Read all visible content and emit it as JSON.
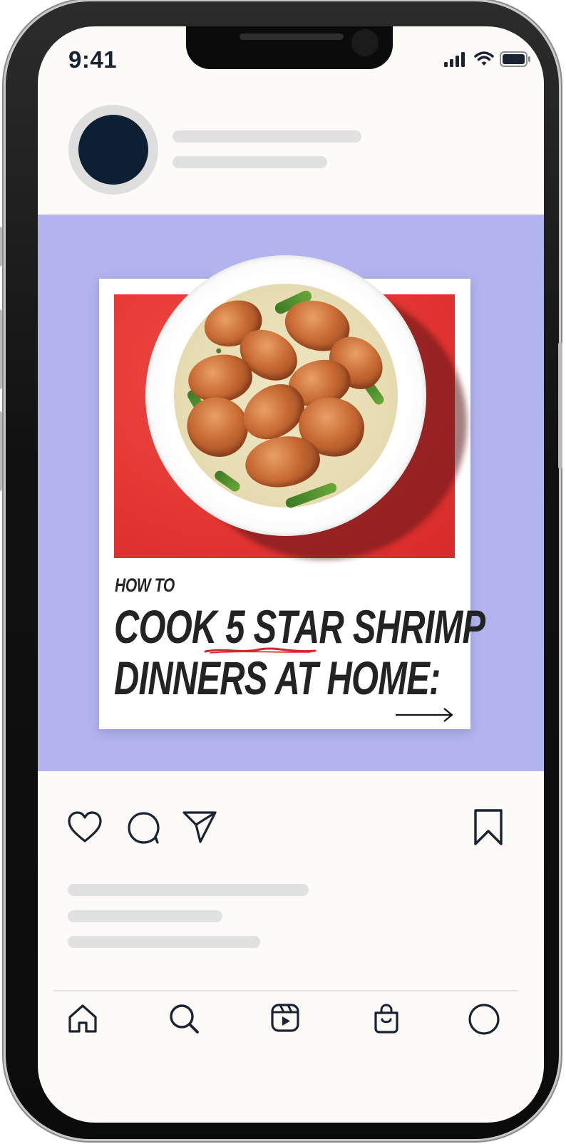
{
  "status_bar": {
    "time": "9:41"
  },
  "post": {
    "kicker": "HOW TO",
    "headline_line1_before": "COOK ",
    "headline_highlight": "5 STAR",
    "headline_line1_after": " SHRIMP",
    "headline_line2": "DINNERS AT HOME:",
    "background_color": "#b3b4ef",
    "photo_background_color": "#e43734",
    "highlight_underline_color": "#d9262b"
  },
  "icons": {
    "status": [
      "signal-icon",
      "wifi-icon",
      "battery-icon"
    ],
    "actions": [
      "heart-icon",
      "comment-icon",
      "send-icon",
      "bookmark-icon"
    ],
    "nav": [
      "home-icon",
      "search-icon",
      "reels-icon",
      "shop-icon",
      "profile-icon"
    ]
  },
  "colors": {
    "icon": "#1a2331",
    "avatar": "#0d1f33",
    "placeholder": "#e1e1e1",
    "screen": "#fcfbf7"
  }
}
